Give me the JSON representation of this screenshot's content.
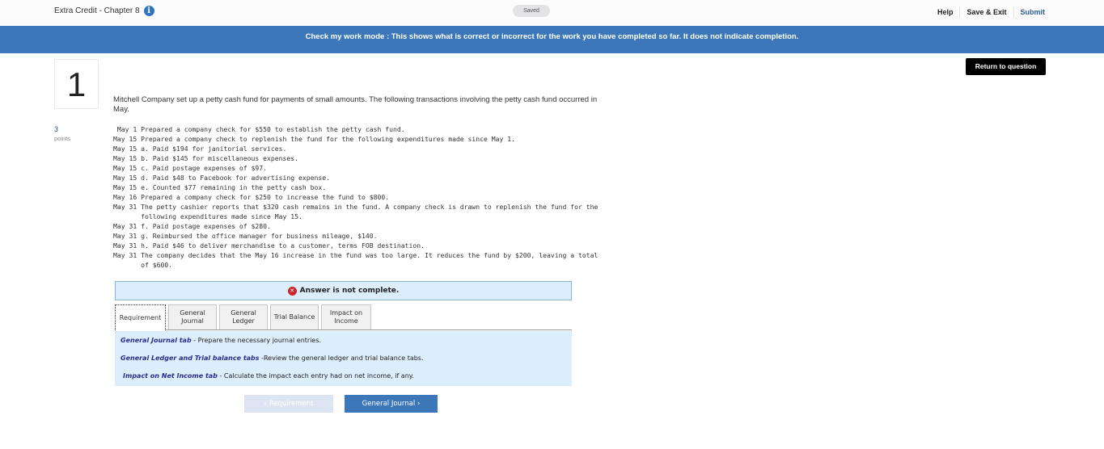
{
  "header": {
    "title": "Extra Credit - Chapter 8",
    "info_icon": "info-icon",
    "saved_status": "Saved",
    "help": "Help",
    "save_exit": "Save & Exit",
    "submit": "Submit"
  },
  "banner": {
    "text": "Check my work mode : This shows what is correct or incorrect for the work you have completed so far. It does not indicate completion."
  },
  "question": {
    "number": "1",
    "points_value": "3",
    "points_label": "points",
    "return_button": "Return to question",
    "intro": "Mitchell Company set up a petty cash fund for payments of small amounts. The following transactions involving the petty cash fund occurred in May.",
    "transactions": [
      " May 1 Prepared a company check for $550 to establish the petty cash fund.",
      "May 15 Prepared a company check to replenish the fund for the following expenditures made since May 1.",
      "May 15 a. Paid $194 for janitorial services.",
      "May 15 b. Paid $145 for miscellaneous expenses.",
      "May 15 c. Paid postage expenses of $97.",
      "May 15 d. Paid $48 to Facebook for advertising expense.",
      "May 15 e. Counted $77 remaining in the petty cash box.",
      "May 16 Prepared a company check for $250 to increase the fund to $800.",
      "May 31 The petty cashier reports that $320 cash remains in the fund. A company check is drawn to replenish the fund for the",
      "       following expenditures made since May 15.",
      "May 31 f. Paid postage expenses of $280.",
      "May 31 g. Reimbursed the office manager for business mileage, $140.",
      "May 31 h. Paid $46 to deliver merchandise to a customer, terms FOB destination.",
      "May 31 The company decides that the May 16 increase in the fund was too large. It reduces the fund by $200, leaving a total",
      "       of $600."
    ]
  },
  "status": {
    "icon": "error-x-icon",
    "text": "Answer is not complete."
  },
  "tabs": [
    {
      "label": "Requirement",
      "active": true
    },
    {
      "label": "General\nJournal",
      "active": false
    },
    {
      "label": "General\nLedger",
      "active": false
    },
    {
      "label": "Trial Balance",
      "active": false
    },
    {
      "label": "Impact on\nIncome",
      "active": false
    }
  ],
  "requirements": [
    {
      "title": "General Journal tab",
      "text": " - Prepare the necessary journal entries."
    },
    {
      "title": "General Ledger and Trial balance tabs",
      "text": " -Review the general ledger and trial balance tabs."
    },
    {
      "title": "Impact on Net Income tab",
      "text": " - Calculate the impact each entry had on net income, if any."
    }
  ],
  "nav": {
    "prev": "‹  Requirement",
    "next": "General Journal  ›"
  },
  "colors": {
    "banner": "#3b77b9",
    "submit": "#2b5c9e",
    "error": "#c8282c",
    "panel": "#dceefb"
  }
}
